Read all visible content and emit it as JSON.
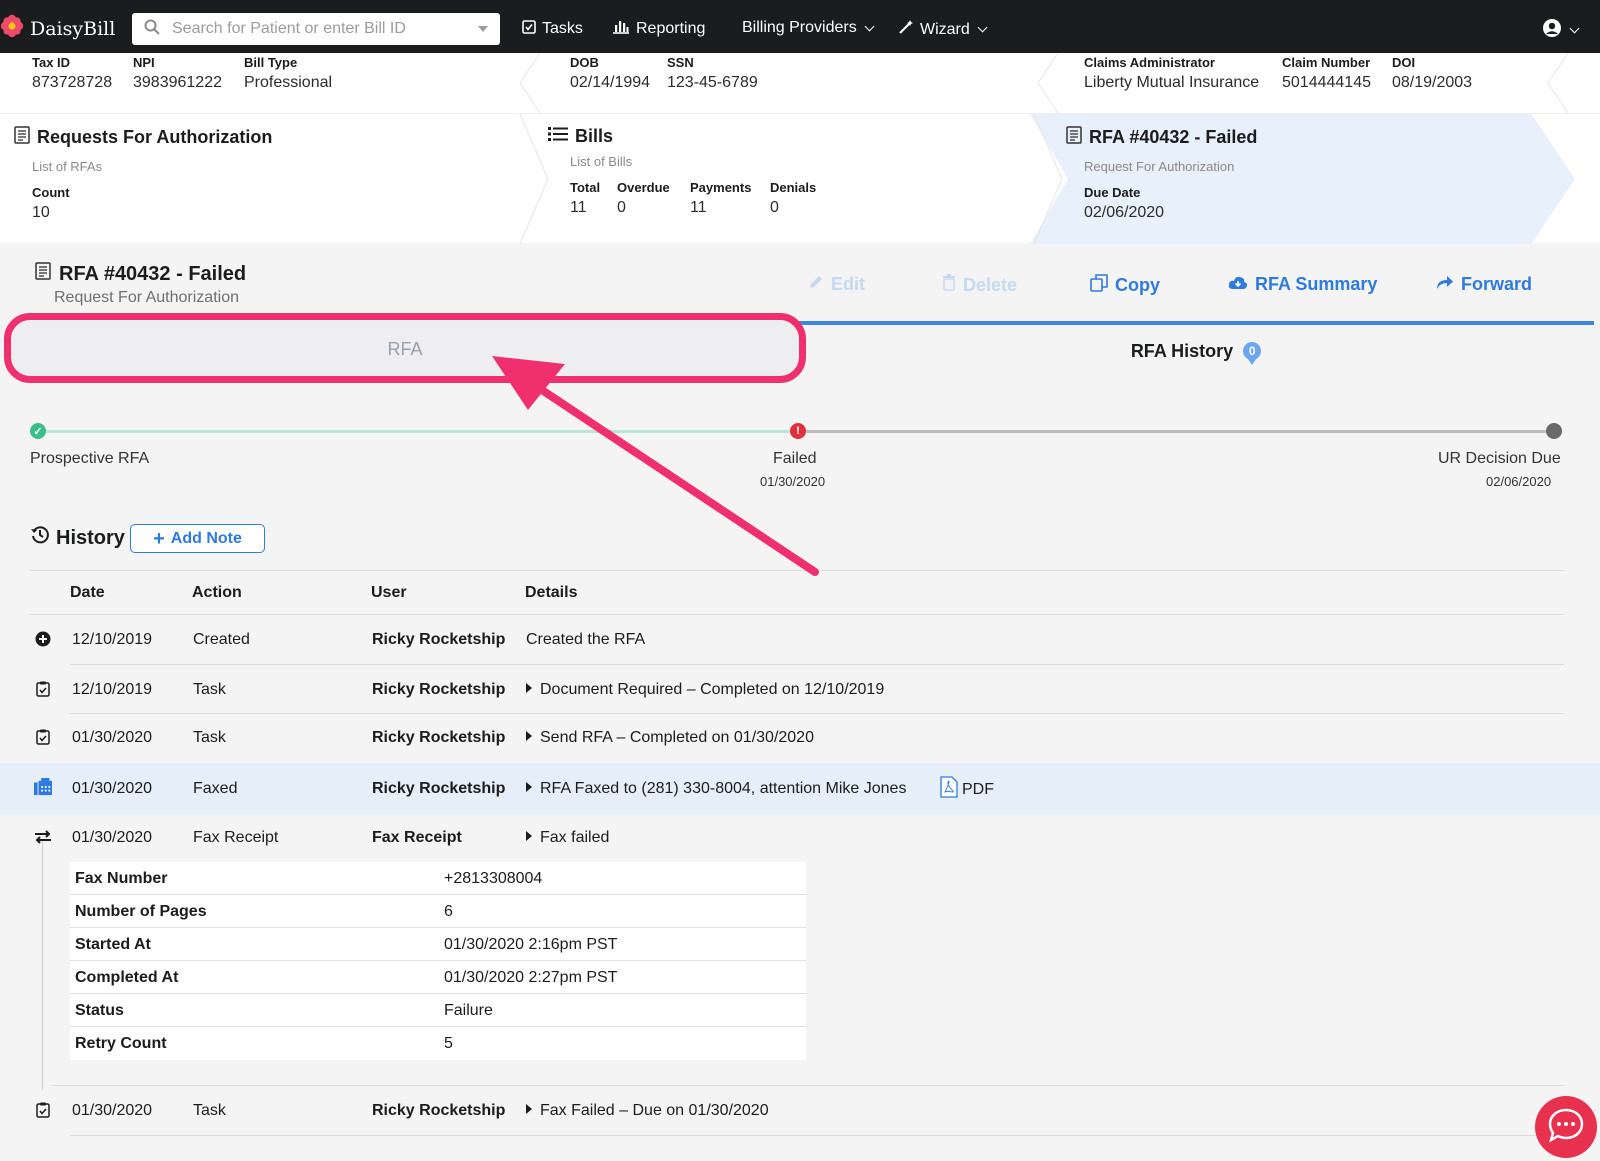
{
  "nav": {
    "brand": "DaisyBill",
    "search_placeholder": "Search for Patient or enter Bill ID",
    "tasks": "Tasks",
    "reporting": "Reporting",
    "billing_providers": "Billing Providers",
    "wizard": "Wizard"
  },
  "info": {
    "tax_id_label": "Tax ID",
    "tax_id": "873728728",
    "npi_label": "NPI",
    "npi": "3983961222",
    "bill_type_label": "Bill Type",
    "bill_type": "Professional",
    "dob_label": "DOB",
    "dob": "02/14/1994",
    "ssn_label": "SSN",
    "ssn": "123-45-6789",
    "claims_admin_label": "Claims Administrator",
    "claims_admin": "Liberty Mutual Insurance",
    "claim_number_label": "Claim Number",
    "claim_number": "5014444145",
    "doi_label": "DOI",
    "doi": "08/19/2003"
  },
  "cards": {
    "rfas": {
      "title": "Requests For Authorization",
      "sub": "List of RFAs",
      "count_label": "Count",
      "count": "10"
    },
    "bills": {
      "title": "Bills",
      "sub": "List of Bills",
      "total_label": "Total",
      "total": "11",
      "overdue_label": "Overdue",
      "overdue": "0",
      "payments_label": "Payments",
      "payments": "11",
      "denials_label": "Denials",
      "denials": "0"
    },
    "rfa": {
      "title": "RFA #40432 - Failed",
      "sub": "Request For Authorization",
      "due_label": "Due Date",
      "due": "02/06/2020"
    }
  },
  "header": {
    "title": "RFA #40432 - Failed",
    "subtitle": "Request For Authorization",
    "edit": "Edit",
    "delete": "Delete",
    "copy": "Copy",
    "summary": "RFA Summary",
    "forward": "Forward"
  },
  "tabs": {
    "rfa": "RFA",
    "history": "RFA History",
    "history_badge": "0"
  },
  "progress": {
    "start": "Prospective RFA",
    "failed": "Failed",
    "failed_date": "01/30/2020",
    "end": "UR Decision Due",
    "end_date": "02/06/2020"
  },
  "history": {
    "title": "History",
    "add_note": "Add Note",
    "columns": [
      "Date",
      "Action",
      "User",
      "Details"
    ],
    "rows": [
      {
        "date": "12/10/2019",
        "action": "Created",
        "user": "Ricky Rocketship",
        "details": "Created the RFA"
      },
      {
        "date": "12/10/2019",
        "action": "Task",
        "user": "Ricky Rocketship",
        "details": "Document Required – Completed on 12/10/2019"
      },
      {
        "date": "01/30/2020",
        "action": "Task",
        "user": "Ricky Rocketship",
        "details": "Send RFA – Completed on 01/30/2020"
      },
      {
        "date": "01/30/2020",
        "action": "Faxed",
        "user": "Ricky Rocketship",
        "details": "RFA Faxed to (281) 330-8004, attention Mike Jones",
        "attachment": "PDF"
      },
      {
        "date": "01/30/2020",
        "action": "Fax Receipt",
        "user": "Fax Receipt",
        "details": "Fax failed"
      },
      {
        "date": "01/30/2020",
        "action": "Task",
        "user": "Ricky Rocketship",
        "details": "Fax Failed – Due on 01/30/2020"
      }
    ],
    "fax_receipt": [
      {
        "k": "Fax Number",
        "v": "+2813308004"
      },
      {
        "k": "Number of Pages",
        "v": "6"
      },
      {
        "k": "Started At",
        "v": "01/30/2020 2:16pm PST"
      },
      {
        "k": "Completed At",
        "v": "01/30/2020 2:27pm PST"
      },
      {
        "k": "Status",
        "v": "Failure"
      },
      {
        "k": "Retry Count",
        "v": "5"
      }
    ]
  },
  "colors": {
    "accent": "#2d7be0",
    "highlight": "#f0306e",
    "success": "#3bbf8a",
    "error": "#e0303c"
  },
  "icons": [
    "flower-logo-icon",
    "search-icon",
    "tasks-icon",
    "reporting-icon",
    "wand-icon",
    "user-icon",
    "list-icon",
    "doc-icon",
    "pencil-icon",
    "trash-icon",
    "copy-icon",
    "cloud-icon",
    "forward-icon",
    "history-icon",
    "plus-icon",
    "fax-icon",
    "swap-icon",
    "clipboard-icon",
    "pdf-icon",
    "chat-icon"
  ]
}
